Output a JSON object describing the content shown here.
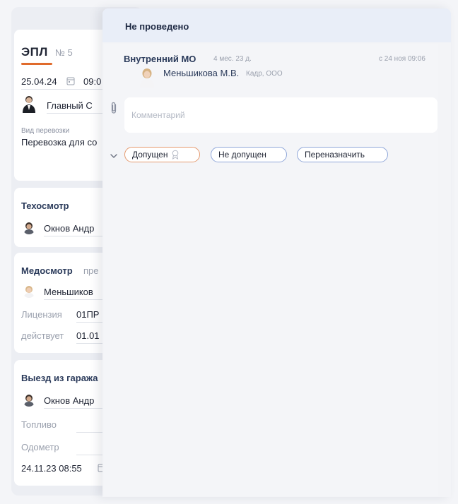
{
  "left_panel": {
    "title": "ЭПЛ",
    "number": "№ 5",
    "date": "25.04.24",
    "time": "09:0",
    "driver": "Главный С",
    "transport_type_label": "Вид перевозки",
    "transport_type_value": "Перевозка для со",
    "techinspection": {
      "title": "Техосмотр",
      "person": "Окнов Андр"
    },
    "medinspection": {
      "title": "Медосмотр",
      "suffix": "пре",
      "person": "Меньшиков",
      "license_label": "Лицензия",
      "license_value": "01ПР",
      "valid_label": "действует",
      "valid_value": "01.01"
    },
    "garage_exit": {
      "title": "Выезд из гаража",
      "person": "Окнов Андр",
      "fuel_label": "Топливо",
      "odometer_label": "Одометр",
      "datetime": "24.11.23  08:55"
    }
  },
  "drawer": {
    "status_title": "Не проведено",
    "section_title": "Внутренний МО",
    "section_age": "4 мес. 23 д.",
    "section_date": "с 24 ноя 09:06",
    "person_name": "Меньшикова М.В.",
    "person_org": "Кадр, ООО",
    "comment_placeholder": "Комментарий",
    "actions": {
      "admit": "Допущен",
      "not_admit": "Не допущен",
      "reassign": "Переназначить"
    }
  },
  "colors": {
    "accent_orange": "#e06b2c",
    "pill_blue_border": "#8fa6d9",
    "pill_orange_border": "#e59a6f",
    "header_bg": "#e9eef8"
  }
}
